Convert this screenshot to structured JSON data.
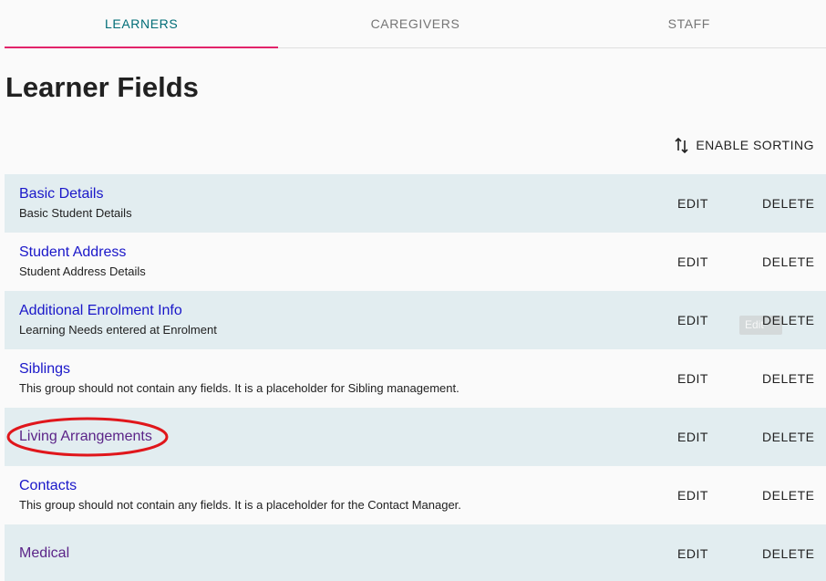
{
  "tabs": [
    {
      "label": "LEARNERS",
      "active": true
    },
    {
      "label": "CAREGIVERS",
      "active": false
    },
    {
      "label": "STAFF",
      "active": false
    }
  ],
  "page_title": "Learner Fields",
  "sort_button": {
    "label": "ENABLE SORTING",
    "icon": "sort-arrows-icon"
  },
  "groups": [
    {
      "name": "Basic Details",
      "description": "Basic Student Details",
      "edit_label": "EDIT",
      "delete_label": "DELETE"
    },
    {
      "name": "Student Address",
      "description": "Student Address Details",
      "edit_label": "EDIT",
      "delete_label": "DELETE"
    },
    {
      "name": "Additional Enrolment Info",
      "description": "Learning Needs entered at Enrolment",
      "edit_label": "EDIT",
      "delete_label": "DELETE",
      "tooltip": "Edit"
    },
    {
      "name": "Siblings",
      "description": "This group should not contain any fields. It is a placeholder for Sibling management.",
      "edit_label": "EDIT",
      "delete_label": "DELETE"
    },
    {
      "name": "Living Arrangements",
      "description": "",
      "edit_label": "EDIT",
      "delete_label": "DELETE"
    },
    {
      "name": "Contacts",
      "description": "This group should not contain any fields. It is a placeholder for the Contact Manager.",
      "edit_label": "EDIT",
      "delete_label": "DELETE"
    },
    {
      "name": "Medical",
      "description": "",
      "edit_label": "EDIT",
      "delete_label": "DELETE"
    }
  ],
  "colors": {
    "tab_active_text": "#006d77",
    "tab_indicator": "#e2246a",
    "link": "#1a17c9",
    "link_visited": "#5b2488",
    "row_shaded": "#e2edf0",
    "annotation": "#e0161b"
  }
}
